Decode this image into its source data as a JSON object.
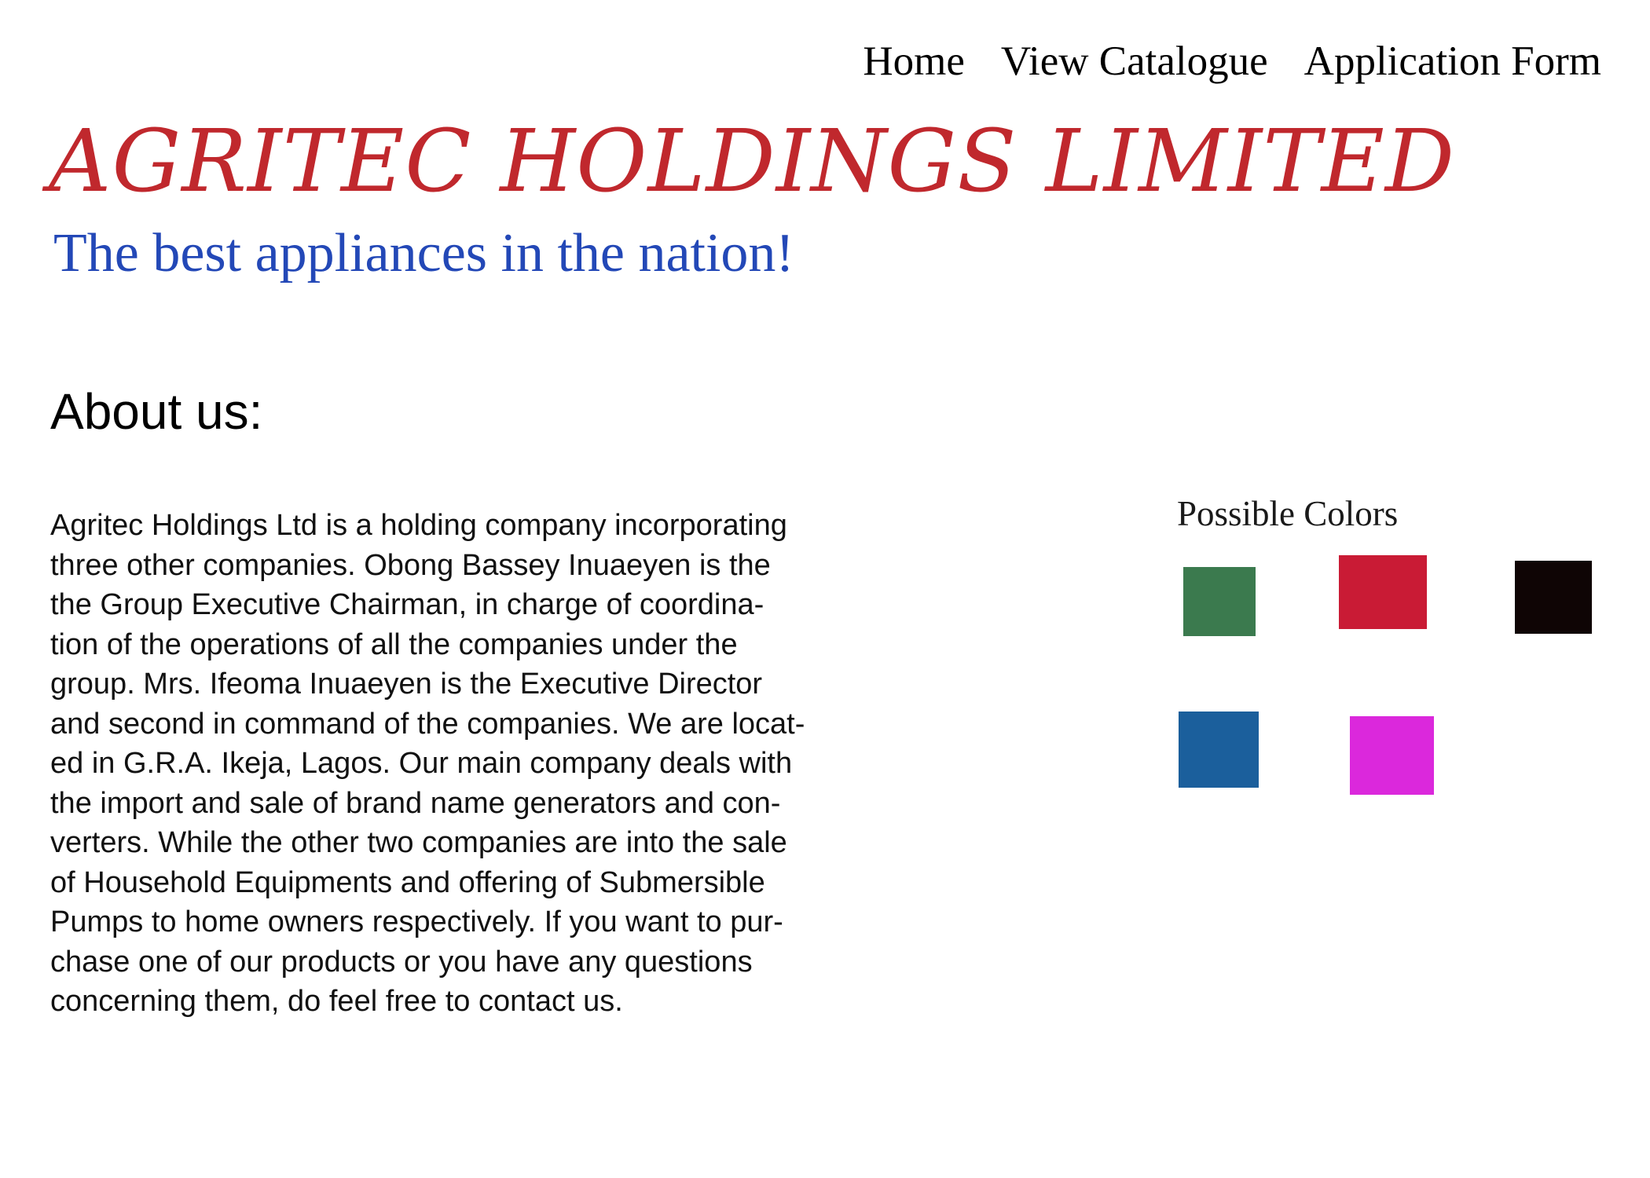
{
  "nav": {
    "items": [
      {
        "label": "Home"
      },
      {
        "label": "View Catalogue"
      },
      {
        "label": "Application Form"
      }
    ]
  },
  "header": {
    "title": "AGRITEC HOLDINGS LIMITED",
    "title_color": "#c0282d",
    "tagline": "The best appliances in the nation!",
    "tagline_color": "#2348b7"
  },
  "about": {
    "heading": "About us:",
    "body_lines": [
      "Agritec Holdings Ltd is a holding company incorporating",
      "three other companies. Obong Bassey Inuaeyen is the",
      "the Group Executive Chairman, in charge of coordina-",
      "tion of the operations of all the companies under the",
      "group. Mrs. Ifeoma Inuaeyen is the Executive Director",
      "and second in command of the companies. We are locat-",
      "ed in G.R.A. Ikeja, Lagos. Our main company deals with",
      "the import and sale of brand name generators and con-",
      "verters. While the other two companies are into the sale",
      "of Household Equipments and offering of Submersible",
      "Pumps to home owners respectively. If you want to pur-",
      "chase one of our products or you have any questions",
      "concerning them, do feel free to contact us."
    ]
  },
  "colors": {
    "title": "Possible Colors",
    "swatches": [
      {
        "name": "green",
        "hex": "#3b7a4e"
      },
      {
        "name": "red",
        "hex": "#c91b35"
      },
      {
        "name": "black",
        "hex": "#0f0505"
      },
      {
        "name": "blue",
        "hex": "#1b5f9c"
      },
      {
        "name": "magenta",
        "hex": "#db28dc"
      }
    ]
  }
}
